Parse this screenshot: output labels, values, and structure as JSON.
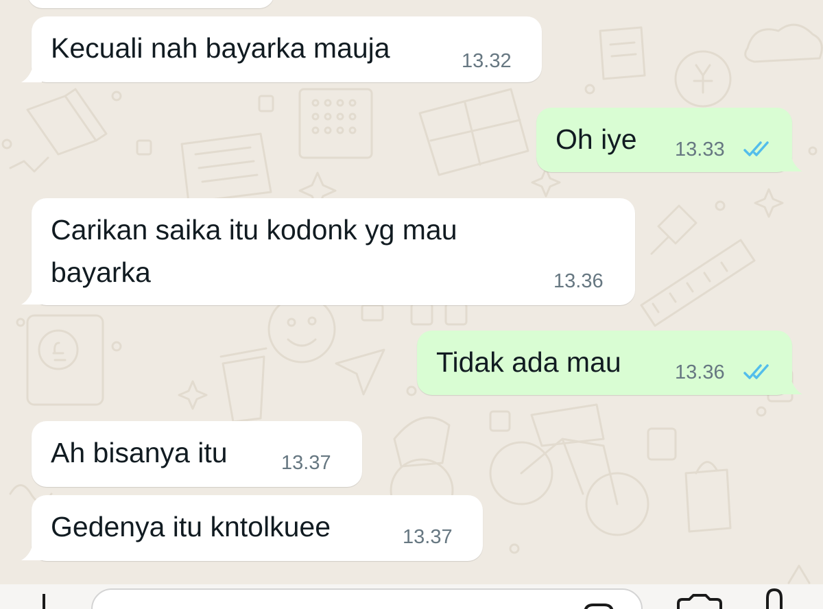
{
  "theme": {
    "background": "#efeae2",
    "incoming_bubble": "#ffffff",
    "outgoing_bubble": "#d9fdd3",
    "text": "#111b21",
    "time": "#667781",
    "read_ticks": "#53bdeb"
  },
  "messages": [
    {
      "direction": "incoming",
      "text": "Kecuali nah bayarka mauja",
      "time": "13.32"
    },
    {
      "direction": "outgoing",
      "text": "Oh iye",
      "time": "13.33",
      "status": "read"
    },
    {
      "direction": "incoming",
      "text_line_1": "Carikan saika itu kodonk yg mau",
      "text_line_2": "bayarka",
      "time": "13.36"
    },
    {
      "direction": "outgoing",
      "text": "Tidak ada mau",
      "time": "13.36",
      "status": "read"
    },
    {
      "direction": "incoming",
      "text": "Ah bisanya itu",
      "time": "13.37"
    },
    {
      "direction": "incoming",
      "text": "Gedenya itu kntolkuee",
      "time": "13.37"
    }
  ],
  "composer": {
    "plus_icon": "plus-icon",
    "sticker_icon": "sticker-icon",
    "camera_icon": "camera-icon",
    "mic_icon": "mic-icon"
  }
}
